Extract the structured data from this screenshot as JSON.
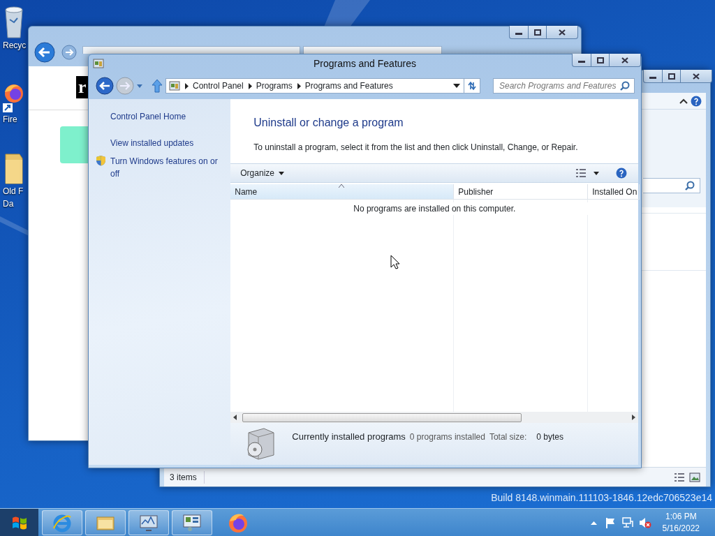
{
  "desktop": {
    "icons": [
      {
        "kind": "bin",
        "lines": [
          "Recyc"
        ]
      },
      {
        "kind": "firefox",
        "lines": [
          "Fire"
        ]
      },
      {
        "kind": "folder",
        "lines": [
          "Old F",
          "Da"
        ]
      }
    ]
  },
  "browser_window": {
    "logo_text": "r"
  },
  "explorer_window": {
    "status": "3 items"
  },
  "window": {
    "title": "Programs and Features",
    "breadcrumb": [
      "Control Panel",
      "Programs",
      "Programs and Features"
    ],
    "search": {
      "placeholder": "Search Programs and Features"
    },
    "sidebar": {
      "items": [
        {
          "label": "Control Panel Home",
          "kind": "link"
        },
        {
          "label": "View installed updates",
          "kind": "link"
        },
        {
          "label": "Turn Windows features on or off",
          "kind": "shield"
        }
      ]
    },
    "heading": "Uninstall or change a program",
    "description": "To uninstall a program, select it from the list and then click Uninstall, Change, or Repair.",
    "toolbar": {
      "organize": "Organize"
    },
    "table": {
      "columns": [
        {
          "label": "Name",
          "sorted": true
        },
        {
          "label": "Publisher",
          "sorted": false
        },
        {
          "label": "Installed On",
          "sorted": false
        }
      ],
      "empty_message": "No programs are installed on this computer."
    },
    "details": {
      "title": "Currently installed programs",
      "count": "0 programs installed",
      "size_label": "Total size:",
      "size": "0 bytes"
    }
  },
  "build": "Build 8148.winmain.111103-1846.12edc706523e14",
  "clock": {
    "time": "1:06 PM",
    "date": "5/16/2022"
  }
}
